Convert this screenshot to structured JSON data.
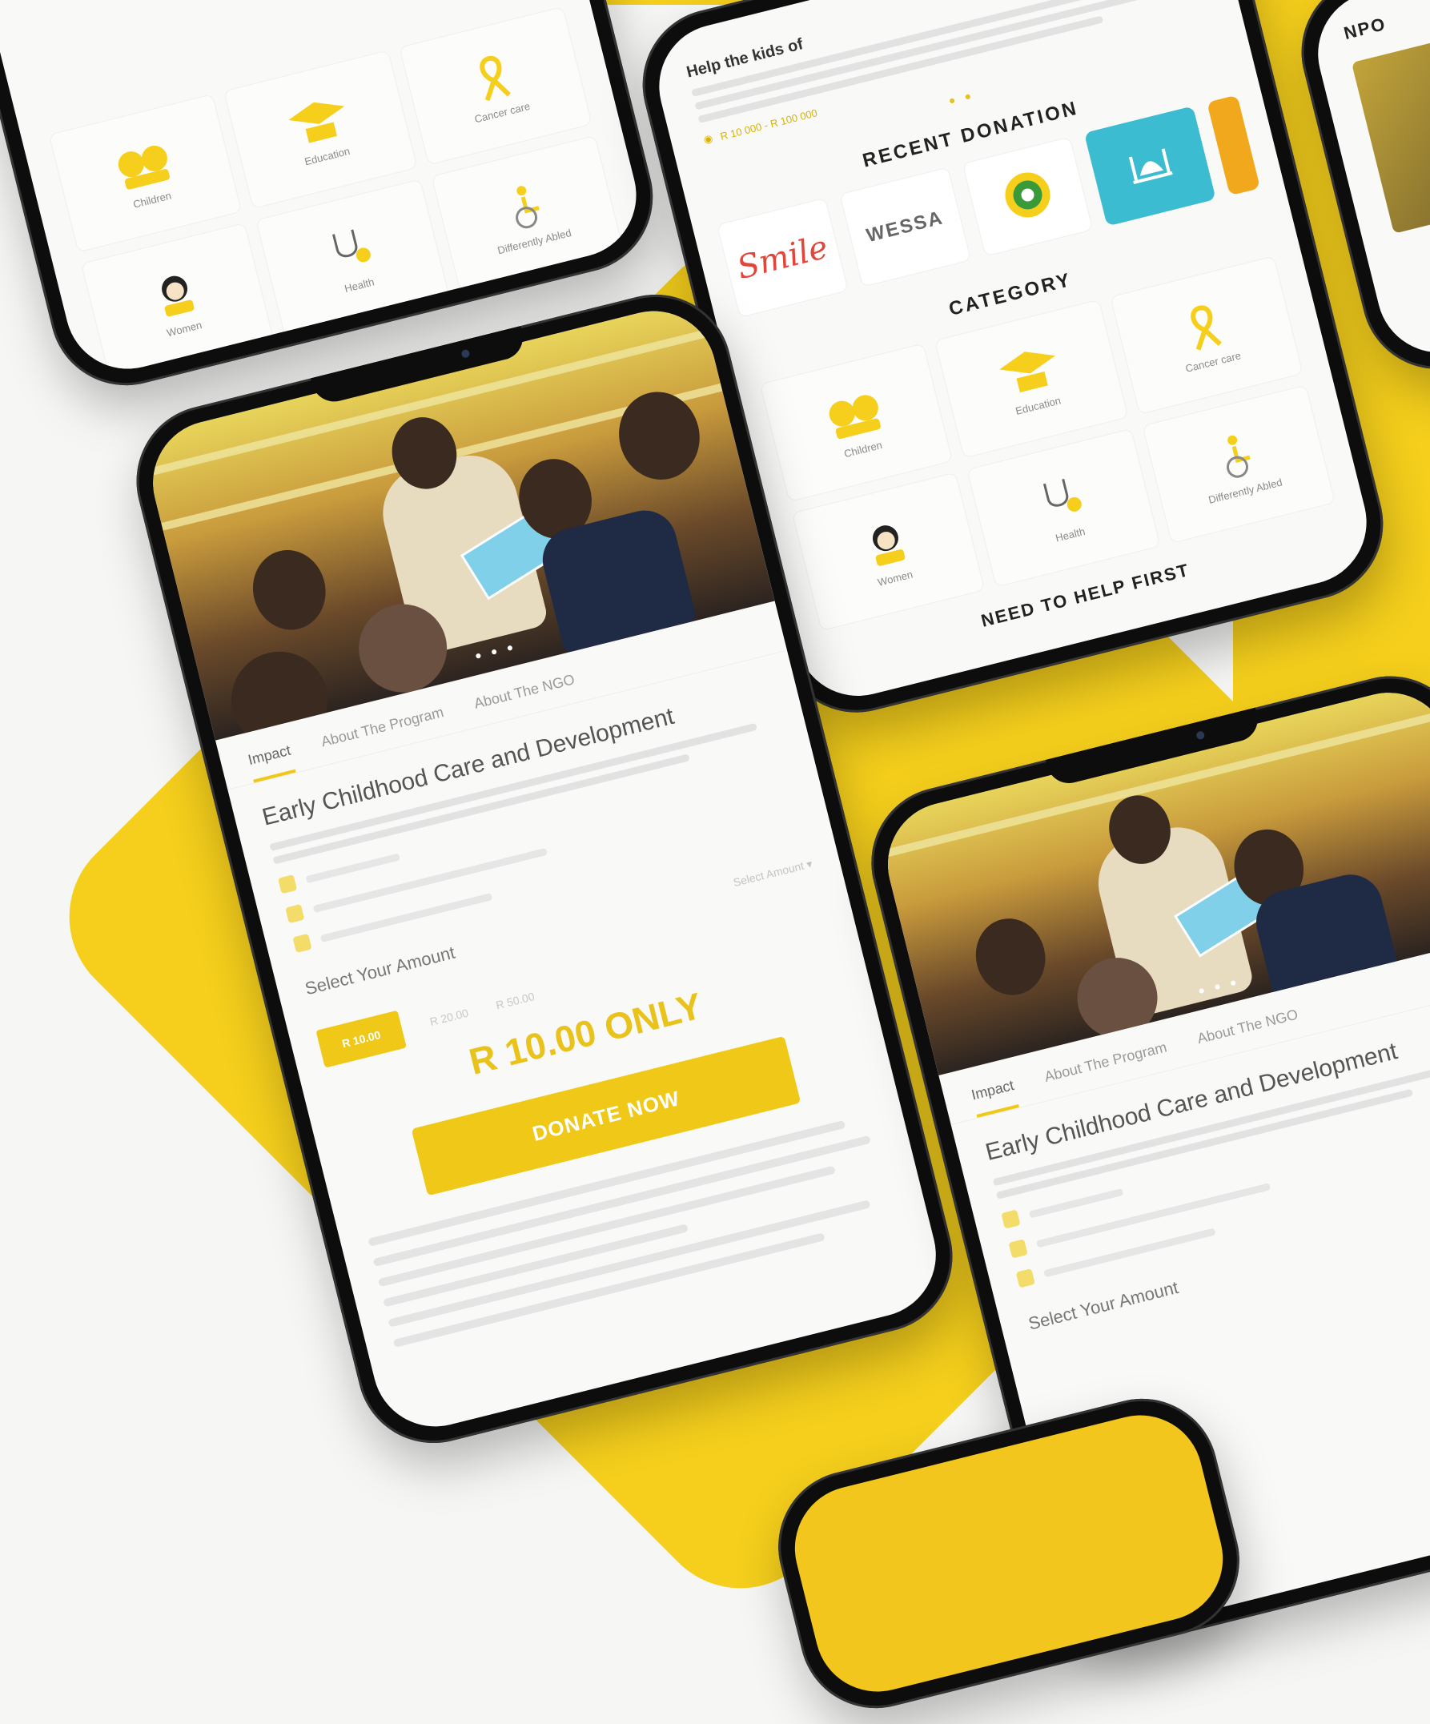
{
  "categories": {
    "title": "CATEGORY",
    "items": [
      {
        "label": "Children",
        "icon": "children-icon"
      },
      {
        "label": "Education",
        "icon": "graduation-cap-icon"
      },
      {
        "label": "Cancer care",
        "icon": "ribbon-icon"
      },
      {
        "label": "Women",
        "icon": "woman-icon"
      },
      {
        "label": "Health",
        "icon": "stethoscope-icon"
      },
      {
        "label": "Differently Abled",
        "icon": "wheelchair-icon"
      }
    ],
    "help_first": "NEED TO HELP FIRST"
  },
  "recent": {
    "title": "RECENT DONATION",
    "heading": "Help the kids of",
    "meta": "R 10 000 - R 100 000",
    "dots": "● ●",
    "logos": [
      "Smile",
      "WESSA"
    ]
  },
  "npo": {
    "label": "NPO"
  },
  "detail": {
    "tabs": [
      "Impact",
      "About The Program",
      "About The NGO"
    ],
    "title": "Early Childhood Care and Development",
    "amount_label": "Select Your Amount",
    "select_placeholder": "Select Amount",
    "amount_options": [
      "R 10.00",
      "R 20.00",
      "R 50.00"
    ],
    "only_text": "R 10.00 ONLY",
    "donate_label": "DONATE NOW",
    "hero_dots": "● ● ●"
  },
  "colors": {
    "accent": "#f5cf1c",
    "teal_logo": "#3cbcd0",
    "smile_red": "#e2463a"
  }
}
